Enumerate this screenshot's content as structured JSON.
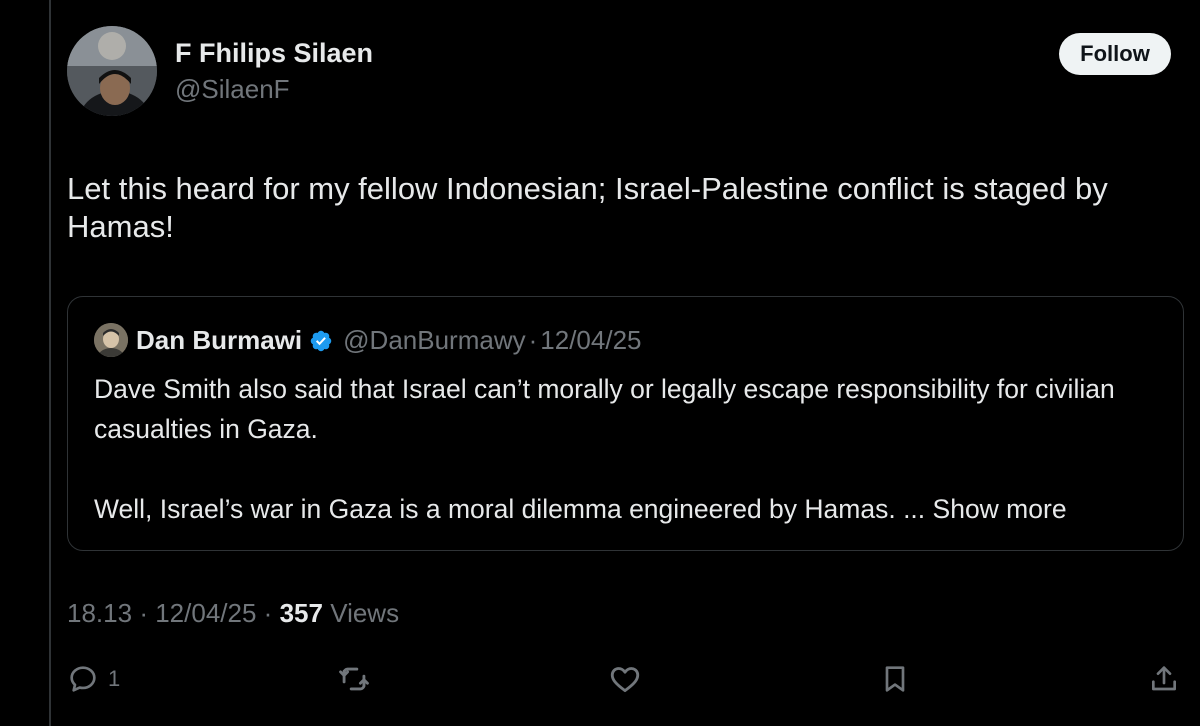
{
  "post": {
    "author_name": "F Fhilips Silaen",
    "author_handle": "@SilaenF",
    "follow_label": "Follow",
    "text": "Let this heard for my fellow Indonesian; Israel-Palestine conflict is staged by Hamas!",
    "time": "18.13",
    "separator": "·",
    "date": "12/04/25",
    "views_count": "357",
    "views_label": "Views"
  },
  "quote": {
    "author_name": "Dan Burmawi",
    "author_handle": "@DanBurmawy",
    "separator": "·",
    "date": "12/04/25",
    "paragraph_1": "Dave Smith also said that Israel can’t morally or legally escape responsibility for civilian casualties in Gaza.",
    "paragraph_2": "Well, Israel’s war in Gaza is a moral dilemma engineered by Hamas. ...",
    "show_more": "Show more"
  },
  "actions": {
    "reply_count": "1"
  },
  "icons": {
    "verified": "verified-badge-icon",
    "reply": "reply-icon",
    "repost": "repost-icon",
    "like": "like-icon",
    "bookmark": "bookmark-icon",
    "share": "share-icon"
  },
  "colors": {
    "background": "#000000",
    "text_primary": "#e7e9ea",
    "text_secondary": "#71767b",
    "border": "#2f3336",
    "verified_blue": "#1d9bf0",
    "follow_button_bg": "#eff3f4"
  }
}
